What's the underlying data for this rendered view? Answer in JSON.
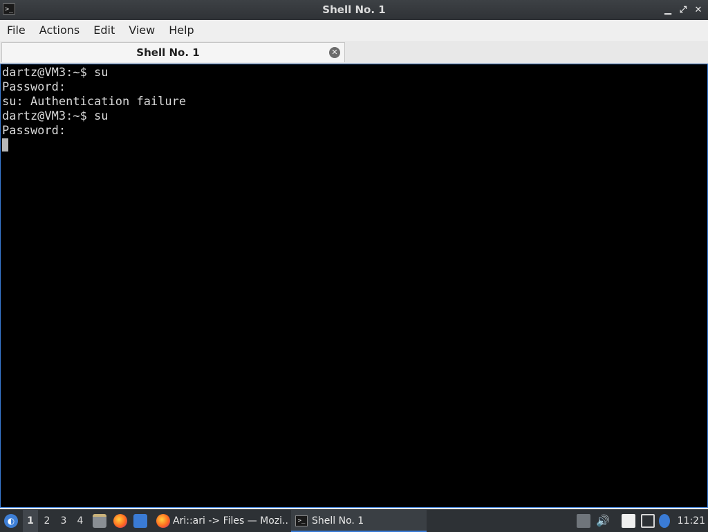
{
  "window": {
    "title": "Shell No. 1",
    "icon": "terminal-icon"
  },
  "menubar": {
    "items": [
      "File",
      "Actions",
      "Edit",
      "View",
      "Help"
    ]
  },
  "tabs": [
    {
      "label": "Shell No. 1",
      "close_icon": "close-icon"
    }
  ],
  "terminal": {
    "lines": [
      "dartz@VM3:~$ su",
      "Password:",
      "su: Authentication failure",
      "dartz@VM3:~$ su",
      "Password:"
    ]
  },
  "taskbar": {
    "workspaces": [
      "1",
      "2",
      "3",
      "4"
    ],
    "active_workspace": "1",
    "tasks": [
      {
        "label": "Ari::ari -> Files — Mozi...",
        "icon": "firefox-icon"
      },
      {
        "label": "Shell No. 1",
        "icon": "terminal-icon"
      }
    ],
    "clock": "11:21"
  },
  "colors": {
    "terminal_bg": "#000000",
    "terminal_fg": "#d8d8d8",
    "accent": "#3a7bd5"
  }
}
